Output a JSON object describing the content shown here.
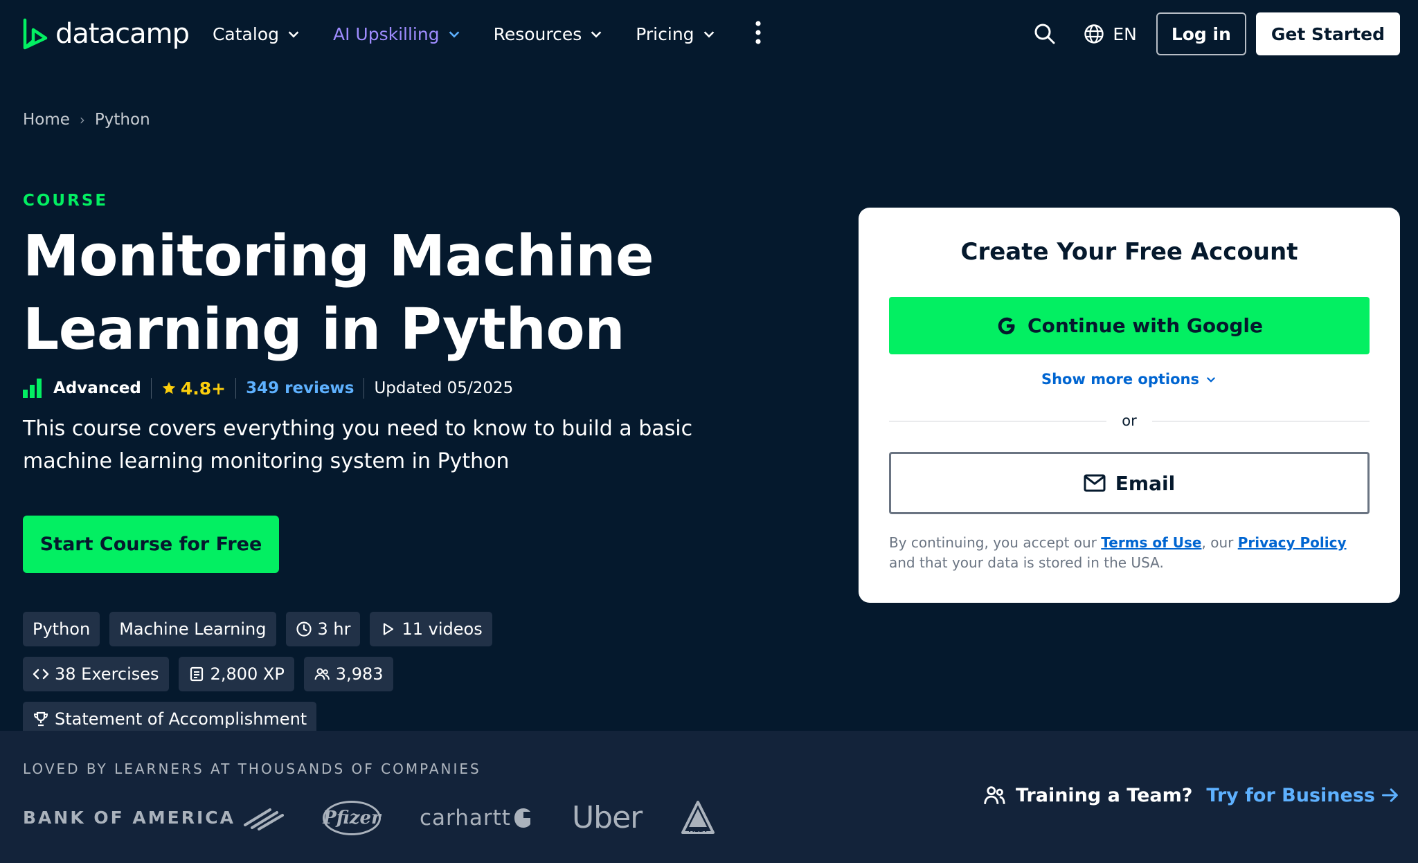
{
  "nav": {
    "logo_text": "datacamp",
    "items": [
      {
        "label": "Catalog"
      },
      {
        "label": "AI Upskilling"
      },
      {
        "label": "Resources"
      },
      {
        "label": "Pricing"
      }
    ],
    "language": "EN",
    "login_label": "Log in",
    "get_started_label": "Get Started"
  },
  "breadcrumb": {
    "items": [
      {
        "label": "Home"
      },
      {
        "label": "Python"
      }
    ],
    "separator": "›"
  },
  "hero": {
    "eyebrow": "COURSE",
    "title": "Monitoring Machine Learning in Python",
    "level": "Advanced",
    "rating": "4.8+",
    "reviews": "349 reviews",
    "updated": "Updated 05/2025",
    "description": "This course covers everything you need to know to build a basic machine learning monitoring system in Python",
    "cta_label": "Start Course for Free",
    "tags": {
      "python": "Python",
      "ml": "Machine Learning",
      "duration": "3 hr",
      "videos": "11 videos",
      "exercises": "38 Exercises",
      "xp": "2,800 XP",
      "learners": "3,983",
      "statement": "Statement of Accomplishment"
    }
  },
  "signup": {
    "title": "Create Your Free Account",
    "google_label": "Continue with Google",
    "more_options": "Show more options",
    "or": "or",
    "email_label": "Email",
    "legal_prefix": "By continuing, you accept our ",
    "terms": "Terms of Use",
    "legal_mid": ", our ",
    "privacy": "Privacy Policy",
    "legal_suffix": " and that your data is stored in the USA."
  },
  "band": {
    "title": "LOVED BY LEARNERS AT THOUSANDS OF COMPANIES",
    "brands": {
      "boa": "BANK OF AMERICA",
      "pfizer": "Pfizer",
      "carhartt": "carhartt",
      "uber": "Uber",
      "aldi": "ALDI"
    },
    "team_label": "Training a Team?",
    "team_link": "Try for Business"
  },
  "colors": {
    "background": "#05192d",
    "accent_green": "#03ef62",
    "link_blue": "#5eb1ff",
    "ai_purple": "#9f8cff",
    "rating_yellow": "#fcce0d",
    "band_bg": "#13233a"
  },
  "icons": [
    "datacamp-logo-icon",
    "chevron-down-icon",
    "kebab-menu-icon",
    "search-icon",
    "globe-icon",
    "level-bars-icon",
    "star-icon",
    "clock-icon",
    "play-icon",
    "code-icon",
    "xp-icon",
    "users-icon",
    "trophy-icon",
    "google-icon",
    "mail-icon",
    "team-icon",
    "arrow-right-icon"
  ]
}
